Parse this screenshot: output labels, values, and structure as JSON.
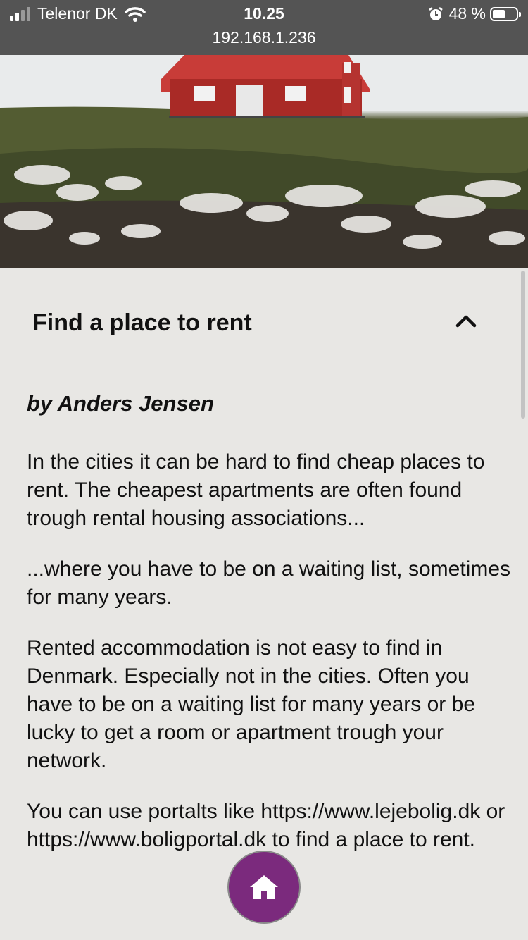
{
  "status_bar": {
    "carrier": "Telenor DK",
    "time": "10.25",
    "url": "192.168.1.236",
    "battery_percent": "48 %",
    "battery_level": 0.48
  },
  "hero": {
    "image": "red-house-on-hill-photo"
  },
  "accordion": {
    "title": "Find a place to rent",
    "expanded": true,
    "toggle_icon": "chevron-up-icon"
  },
  "article": {
    "author": "by Anders Jensen",
    "paragraphs": [
      "In the cities it can be hard to find cheap places to rent. The cheapest apartments are often found trough rental housing associations...",
      "...where you have to be on a waiting list, sometimes for many years.",
      "Rented accommodation is not easy to find in Denmark. Especially not in the cities. Often you have to be on a waiting list for many years or be lucky to get a room or apartment trough your network.",
      "You can use portalts like https://www.lejebolig.dk or https://www.boligportal.dk to find a place to rent."
    ]
  },
  "fab": {
    "icon": "home-icon",
    "color": "#7b2a7d"
  }
}
